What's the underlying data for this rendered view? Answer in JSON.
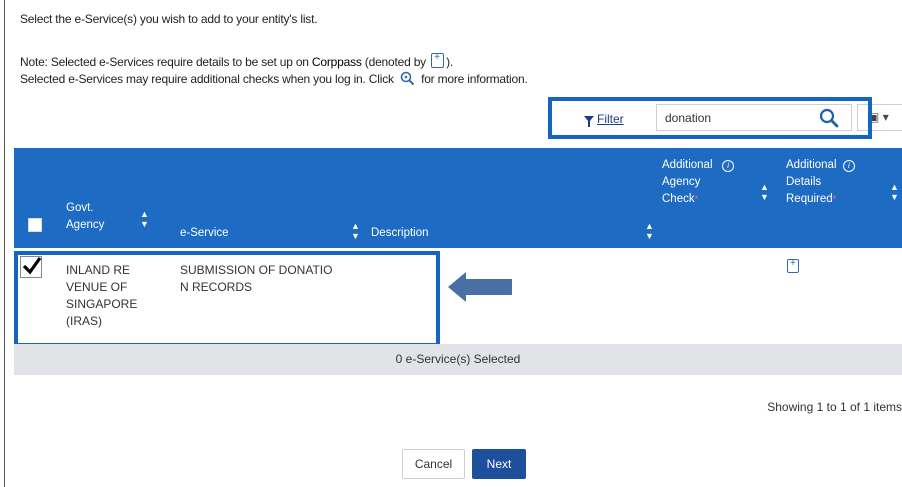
{
  "intro": "Select the e-Service(s) you wish to add to your entity's list.",
  "note": {
    "line1_prefix": "Note: Selected e-Services require details to be set up on ",
    "corppass": "Corppass",
    "line1_mid": " (denoted by ",
    "line1_suffix": ").",
    "line2_prefix": "Selected e-Services may require additional checks when you log in. Click ",
    "line2_suffix": " for more information."
  },
  "toolbar": {
    "filter_label": "Filter",
    "search_value": "donation"
  },
  "table": {
    "headers": {
      "agency_line1": "Govt.",
      "agency_line2": "Agency",
      "eservice": "e-Service",
      "description": "Description",
      "check_line1": "Additional",
      "check_line2": "Agency",
      "check_line3": "Check",
      "details_line1": "Additional",
      "details_line2": "Details",
      "details_line3": "Required"
    },
    "rows": [
      {
        "agency_lines": [
          "INLAND RE",
          "VENUE OF",
          "SINGAPORE",
          "(IRAS)"
        ],
        "eservice_lines": [
          "SUBMISSION OF DONATIO",
          "N RECORDS"
        ],
        "checked": true
      }
    ],
    "selected_summary": "0 e-Service(s) Selected",
    "showing": "Showing 1 to 1 of 1 items"
  },
  "buttons": {
    "cancel": "Cancel",
    "next": "Next"
  },
  "colors": {
    "header_blue": "#1e6bc4",
    "highlight_blue": "#1565c0",
    "next_button": "#1e4f9c",
    "arrow": "#4a6fa5"
  }
}
